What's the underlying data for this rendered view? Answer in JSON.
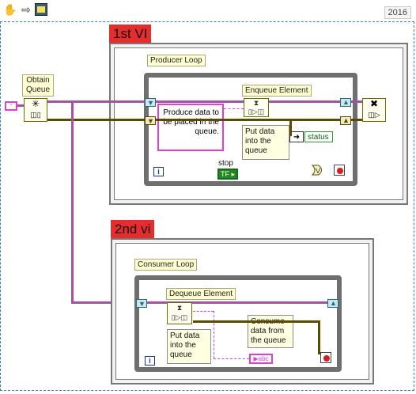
{
  "toolbar": {
    "icons": [
      "hand-icon",
      "arrow-icon",
      "vi-icon"
    ],
    "year": "2016"
  },
  "producer": {
    "vi_label": "1st VI",
    "loop_label": "Producer Loop",
    "produce_text": "Produce data to be placed in the queue.",
    "enqueue_label": "Enqueue Element",
    "put_note": "Put data into the queue",
    "status_label": "status",
    "stop_label": "stop",
    "iteration": "i",
    "tf": "TF"
  },
  "obtain": {
    "label": "Obtain Queue"
  },
  "consumer": {
    "vi_label": "2nd vi",
    "loop_label": "Consumer Loop",
    "dequeue_label": "Dequeue Element",
    "put_note": "Put data into the queue",
    "consume_text": "Consume data from the queue",
    "iteration": "i",
    "string_tag": "abc"
  },
  "colors": {
    "queue_wire": "#a552a5",
    "error_wire": "#5a4b00",
    "vi_label": "#e62d2d"
  }
}
